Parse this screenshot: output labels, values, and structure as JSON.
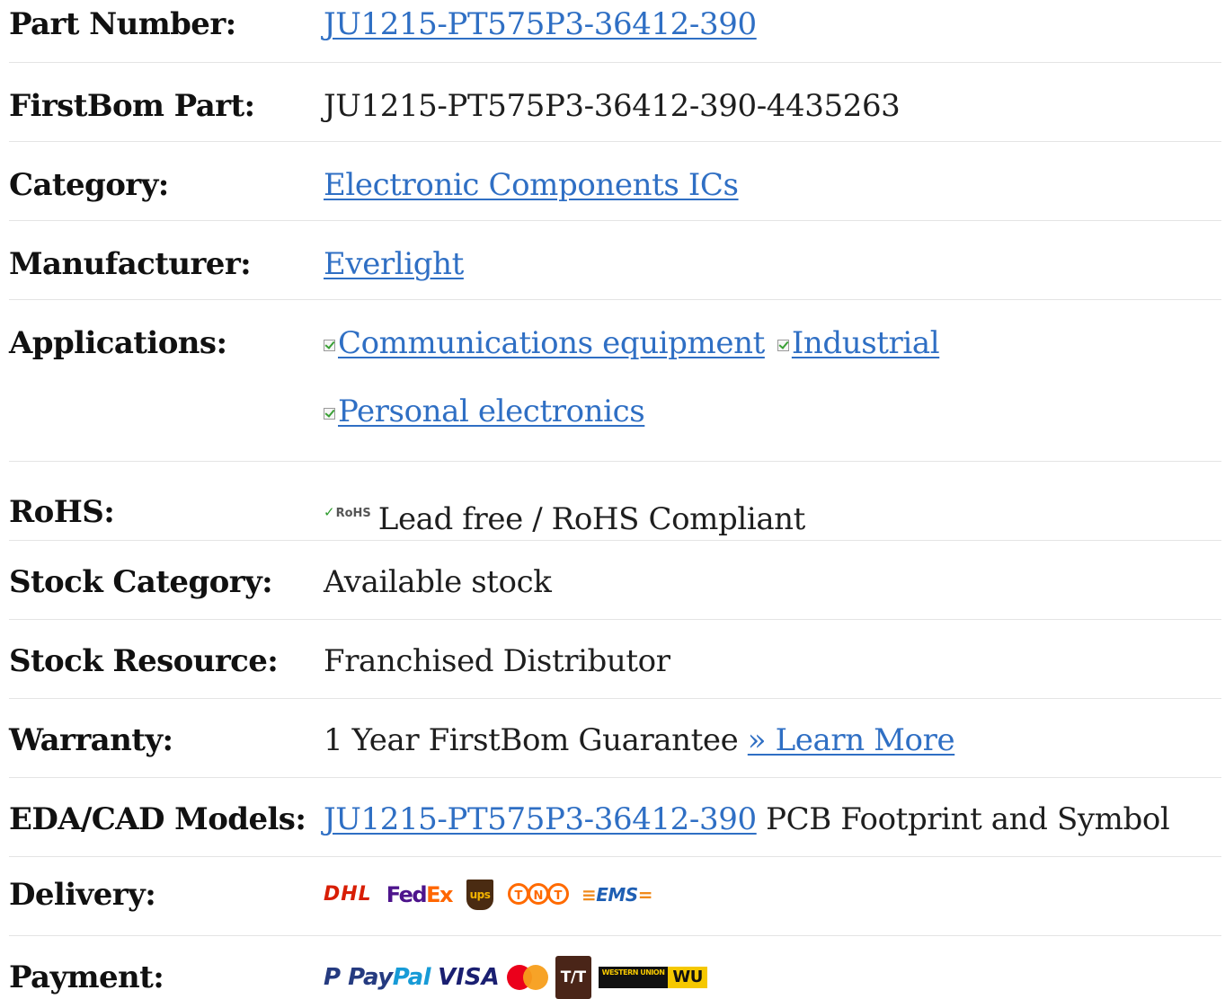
{
  "rows": {
    "part_number": {
      "label": "Part Number:",
      "value": "JU1215-PT575P3-36412-390"
    },
    "firstbom_part": {
      "label": "FirstBom Part:",
      "value": "JU1215-PT575P3-36412-390-4435263"
    },
    "category": {
      "label": "Category:",
      "value": "Electronic Components ICs"
    },
    "manufacturer": {
      "label": "Manufacturer:",
      "value": "Everlight"
    },
    "applications": {
      "label": "Applications:",
      "items": [
        "Communications equipment",
        "Industrial",
        "Personal electronics"
      ]
    },
    "rohs": {
      "label": "RoHS:",
      "logo_text": "RoHS",
      "value": "Lead free / RoHS Compliant"
    },
    "stock_category": {
      "label": "Stock Category:",
      "value": "Available stock"
    },
    "stock_resource": {
      "label": "Stock Resource:",
      "value": "Franchised Distributor"
    },
    "warranty": {
      "label": "Warranty:",
      "value": "1 Year FirstBom Guarantee",
      "link": "» Learn More"
    },
    "eda": {
      "label": "EDA/CAD Models:",
      "link": "JU1215-PT575P3-36412-390",
      "suffix": "PCB Footprint and Symbol"
    },
    "delivery": {
      "label": "Delivery:",
      "carriers": {
        "dhl": "DHL",
        "fedex_a": "Fed",
        "fedex_b": "Ex",
        "ups": "ups",
        "tnt": [
          "T",
          "N",
          "T"
        ],
        "ems": "EMS"
      }
    },
    "payment": {
      "label": "Payment:",
      "methods": {
        "paypal_a": "Pay",
        "paypal_b": "Pal",
        "visa": "VISA",
        "tt": "T/T",
        "wu_small": "WESTERN UNION",
        "wu": "WU"
      }
    }
  }
}
